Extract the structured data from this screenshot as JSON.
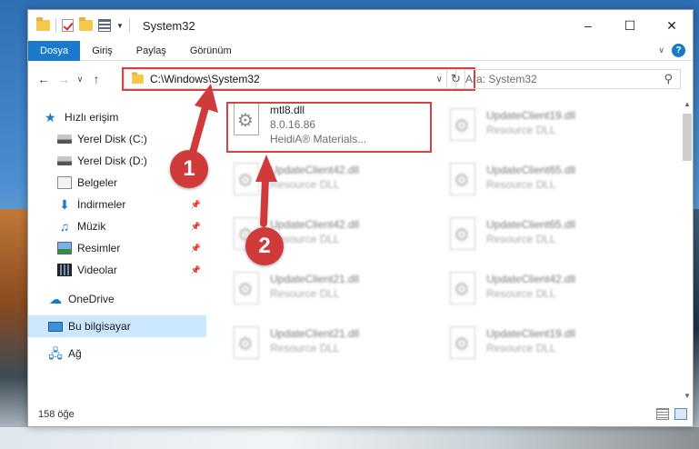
{
  "window": {
    "title": "System32",
    "controls": [
      "–",
      "☐",
      "✕"
    ]
  },
  "ribbon": {
    "tabs": [
      "Dosya",
      "Giriş",
      "Paylaş",
      "Görünüm"
    ]
  },
  "address": {
    "path": "C:\\Windows\\System32",
    "search_placeholder": "Ara: System32"
  },
  "nav": {
    "quick_access": "Hızlı erişim",
    "items": [
      {
        "label": "Yerel Disk (C:)",
        "pinned": true
      },
      {
        "label": "Yerel Disk (D:)",
        "pinned": false
      },
      {
        "label": "Belgeler",
        "pinned": true
      },
      {
        "label": "İndirmeler",
        "pinned": true
      },
      {
        "label": "Müzik",
        "pinned": true
      },
      {
        "label": "Resimler",
        "pinned": true
      },
      {
        "label": "Videolar",
        "pinned": true
      }
    ],
    "onedrive": "OneDrive",
    "this_pc": "Bu bilgisayar",
    "network": "Ağ"
  },
  "files": {
    "highlighted": {
      "name": "mtl8.dll",
      "version": "8.0.16.86",
      "company": "HeidiA® Materials..."
    },
    "left_column": [
      {
        "name": "UpdateClient42.dll",
        "type": "Resource DLL"
      },
      {
        "name": "UpdateClient42.dll",
        "type": "Resource DLL"
      },
      {
        "name": "UpdateClient21.dll",
        "type": "Resource DLL"
      },
      {
        "name": "UpdateClient21.dll",
        "type": "Resource DLL"
      }
    ],
    "right_column": [
      {
        "name": "UpdateClient19.dll",
        "type": "Resource DLL"
      },
      {
        "name": "UpdateClient65.dll",
        "type": "Resource DLL"
      },
      {
        "name": "UpdateClient65.dll",
        "type": "Resource DLL"
      },
      {
        "name": "UpdateClient42.dll",
        "type": "Resource DLL"
      },
      {
        "name": "UpdateClient19.dll",
        "type": "Resource DLL"
      }
    ]
  },
  "status": {
    "item_count": "158 öğe"
  },
  "annotations": {
    "step1": "1",
    "step2": "2",
    "color": "#d03a3a"
  }
}
